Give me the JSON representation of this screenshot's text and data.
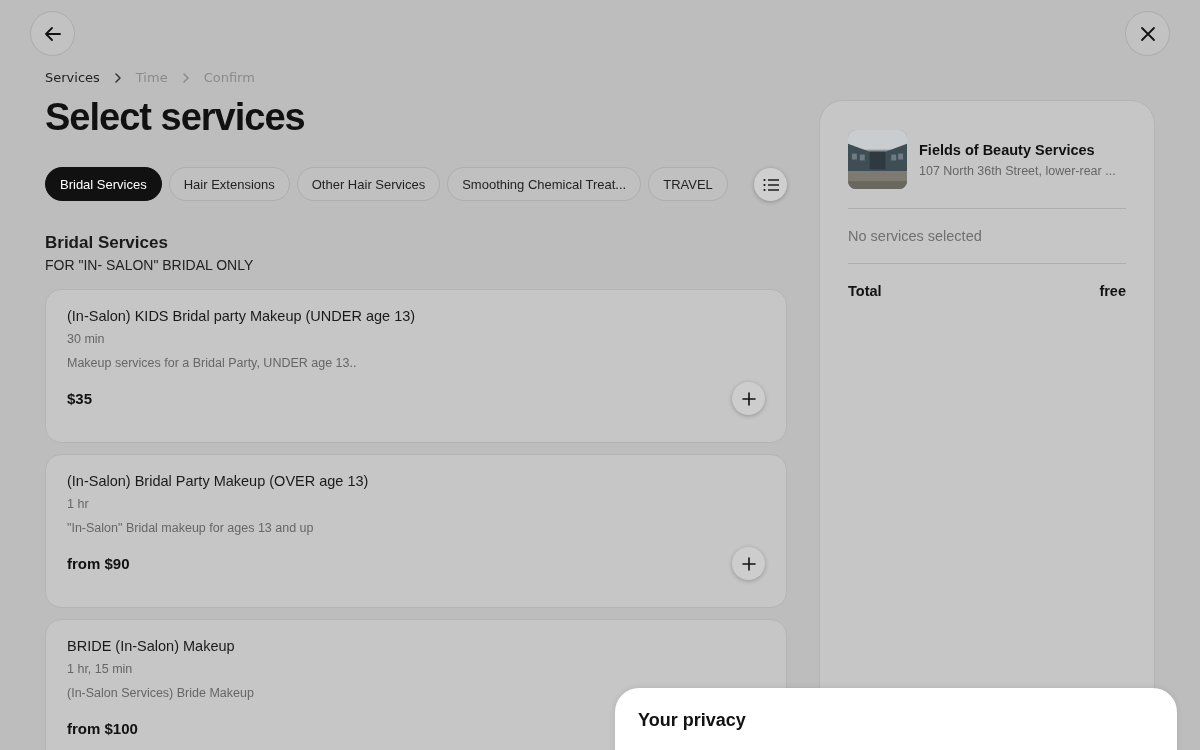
{
  "breadcrumb": [
    {
      "label": "Services",
      "selected": true
    },
    {
      "label": "Time",
      "selected": false
    },
    {
      "label": "Confirm",
      "selected": false
    }
  ],
  "title": "Select services",
  "categories": [
    {
      "label": "Bridal Services",
      "selected": true
    },
    {
      "label": "Hair Extensions",
      "selected": false
    },
    {
      "label": "Other Hair Services",
      "selected": false
    },
    {
      "label": "Smoothing Chemical Treat...",
      "selected": false
    },
    {
      "label": "TRAVEL",
      "selected": false
    }
  ],
  "section": {
    "title": "Bridal Services",
    "subtitle": "FOR \"IN- SALON\" BRIDAL ONLY"
  },
  "services": [
    {
      "name": "(In-Salon) KIDS Bridal party Makeup (UNDER age 13)",
      "duration": "30 min",
      "description": "Makeup services for a Bridal Party, UNDER age 13..",
      "price": "$35"
    },
    {
      "name": "(In-Salon) Bridal Party Makeup (OVER age 13)",
      "duration": "1 hr",
      "description": "\"In-Salon\" Bridal makeup for ages 13 and up",
      "price": "from $90"
    },
    {
      "name": "BRIDE (In-Salon) Makeup",
      "duration": "1 hr, 15 min",
      "description": "(In-Salon Services) Bride Makeup",
      "price": "from $100"
    }
  ],
  "summary": {
    "venue_name": "Fields of Beauty Services",
    "venue_address": "107 North 36th Street, lower-rear ...",
    "empty_text": "No services selected",
    "total_label": "Total",
    "total_value": "free"
  },
  "privacy": {
    "title": "Your privacy"
  }
}
